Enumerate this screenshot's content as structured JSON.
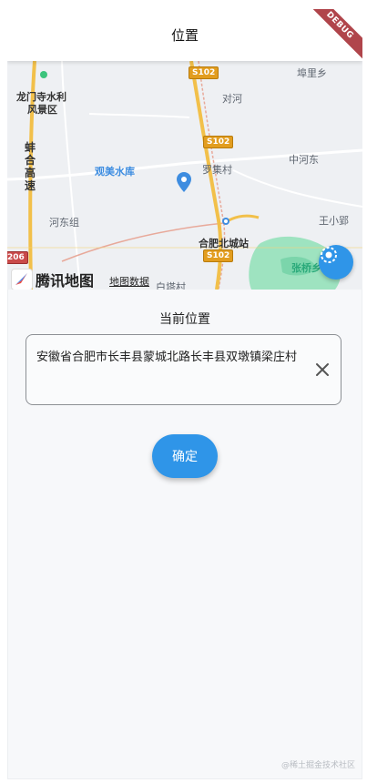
{
  "appbar": {
    "title": "位置"
  },
  "debug_banner": "DEBUG",
  "map": {
    "places": [
      "龙门寺水利",
      "风景区",
      "埠里乡",
      "对河",
      "观美水库",
      "罗集村",
      "中河东",
      "河东组",
      "王小郢",
      "合肥北城站",
      "张桥乡",
      "白塔村"
    ],
    "highway_vertical": "蚌合高速",
    "road_shields": [
      "S102",
      "S102",
      "S102"
    ],
    "edge_shield": "206",
    "logo_text": "腾讯地图",
    "data_link": "地图数据"
  },
  "location": {
    "label": "当前位置",
    "address": "安徽省合肥市长丰县蒙城北路长丰县双墩镇梁庄村"
  },
  "confirm_label": "确定",
  "watermark": "@稀土掘金技术社区",
  "colors": {
    "accent": "#2f95e8",
    "debug": "#b0454b",
    "highway": "#f2c04a"
  },
  "icons": [
    "map-pin-icon",
    "locate-icon",
    "clear-icon",
    "tencent-map-logo-icon"
  ]
}
